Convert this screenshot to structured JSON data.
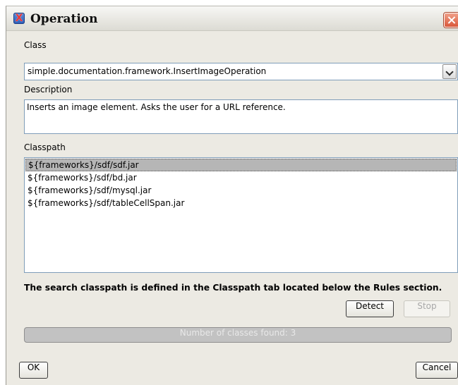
{
  "window": {
    "title": "Operation",
    "app_icon": "x-app-icon",
    "close_icon": "close-icon"
  },
  "class_field": {
    "label": "Class",
    "value": "simple.documentation.framework.InsertImageOperation",
    "dropdown_icon": "chevron-down-icon"
  },
  "description": {
    "label": "Description",
    "value": "Inserts an image element. Asks the user for a URL reference."
  },
  "classpath": {
    "label": "Classpath",
    "items": [
      "${frameworks}/sdf/sdf.jar",
      "${frameworks}/sdf/bd.jar",
      "${frameworks}/sdf/mysql.jar",
      "${frameworks}/sdf/tableCellSpan.jar"
    ],
    "selected_index": 0
  },
  "note": "The search classpath is defined in the Classpath tab located below the Rules section.",
  "buttons": {
    "detect": "Detect",
    "stop": "Stop",
    "ok": "OK",
    "cancel": "Cancel"
  },
  "progress": {
    "text": "Number of classes found: 3"
  },
  "colors": {
    "selection": "#b6b6b6",
    "dialog_bg": "#eceae3",
    "field_border": "#7f9db9"
  }
}
